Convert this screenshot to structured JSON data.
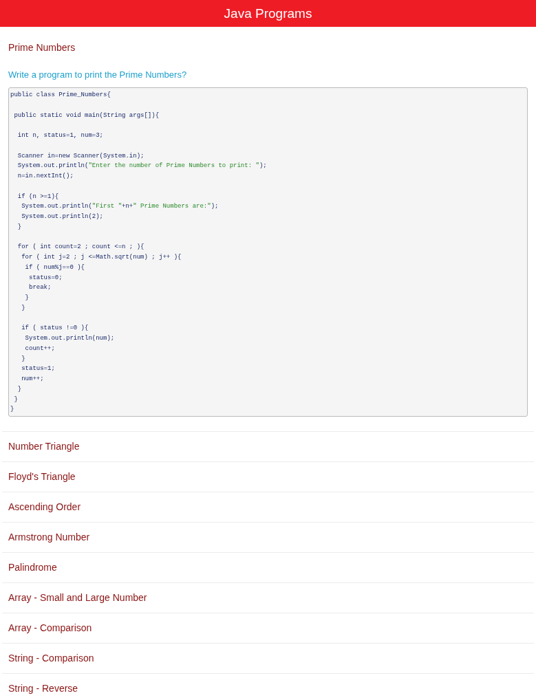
{
  "header": {
    "title": "Java Programs"
  },
  "topics": [
    {
      "title": "Prime Numbers",
      "expanded": true,
      "question": "Write a program to print the Prime Numbers?",
      "code": "public class Prime_Numbers{\n\n public static void main(String args[]){\n\n  int n, status=1, num=3;\n\n  Scanner in=new Scanner(System.in);\n  System.out.println(\"Enter the number of Prime Numbers to print: \");\n  n=in.nextInt();\n\n  if (n >=1){\n   System.out.println(\"First \"+n+\" Prime Numbers are:\");\n   System.out.println(2);\n  }\n\n  for ( int count=2 ; count <=n ; ){\n   for ( int j=2 ; j <=Math.sqrt(num) ; j++ ){\n    if ( num%j==0 ){\n     status=0;\n     break;\n    }\n   }\n\n   if ( status !=0 ){\n    System.out.println(num);\n    count++;\n   }\n   status=1;\n   num++;\n  }\n }\n}"
    },
    {
      "title": "Number Triangle",
      "expanded": false
    },
    {
      "title": "Floyd's Triangle",
      "expanded": false
    },
    {
      "title": "Ascending Order",
      "expanded": false
    },
    {
      "title": "Armstrong Number",
      "expanded": false
    },
    {
      "title": "Palindrome",
      "expanded": false
    },
    {
      "title": "Array - Small and Large Number",
      "expanded": false
    },
    {
      "title": "Array - Comparison",
      "expanded": false
    },
    {
      "title": "String - Comparison",
      "expanded": false
    },
    {
      "title": "String - Reverse",
      "expanded": false
    }
  ]
}
